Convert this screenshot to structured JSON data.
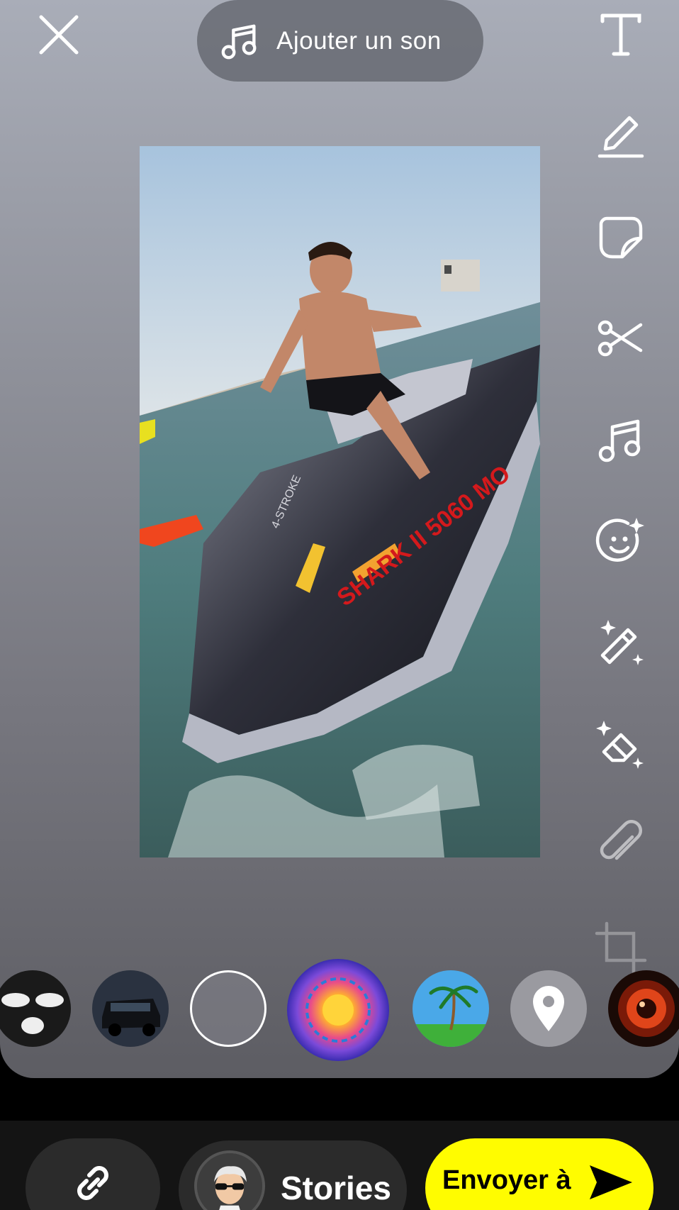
{
  "header": {
    "sound_label": "Ajouter un son",
    "close_icon": "close-icon",
    "sound_icon": "music-note-icon"
  },
  "toolbar": {
    "tools": [
      {
        "name": "text-tool",
        "icon": "text-icon"
      },
      {
        "name": "draw-tool",
        "icon": "pencil-icon"
      },
      {
        "name": "sticker-tool",
        "icon": "sticker-icon"
      },
      {
        "name": "scissors-tool",
        "icon": "scissors-icon"
      },
      {
        "name": "music-tool",
        "icon": "music-note-icon"
      },
      {
        "name": "lenses-tool",
        "icon": "smiley-sparkle-icon"
      },
      {
        "name": "magic-tool",
        "icon": "magic-wand-icon"
      },
      {
        "name": "eraser-tool",
        "icon": "magic-eraser-icon"
      },
      {
        "name": "attach-tool",
        "icon": "paperclip-icon"
      },
      {
        "name": "crop-tool",
        "icon": "crop-icon"
      }
    ]
  },
  "photo": {
    "plate_text": "SHARK II 5060 MO",
    "hull_text": "4-STROKE"
  },
  "lenses": [
    {
      "name": "lens-ski-mask",
      "icon": "ski-mask-icon"
    },
    {
      "name": "lens-car",
      "icon": "car-icon"
    },
    {
      "name": "lens-none",
      "icon": "empty-circle"
    },
    {
      "name": "lens-mandala",
      "icon": "mandala-icon"
    },
    {
      "name": "lens-palm-tree",
      "icon": "palm-tree-icon"
    },
    {
      "name": "lens-location",
      "icon": "location-pin-icon"
    },
    {
      "name": "lens-camera",
      "icon": "camera-lens-icon"
    }
  ],
  "bottom_bar": {
    "stories_label": "Stories",
    "send_label": "Envoyer à",
    "link_icon": "link-icon",
    "send_icon": "send-arrow-icon"
  },
  "colors": {
    "send_button": "#fffc00",
    "bottom_bar": "#141414"
  }
}
